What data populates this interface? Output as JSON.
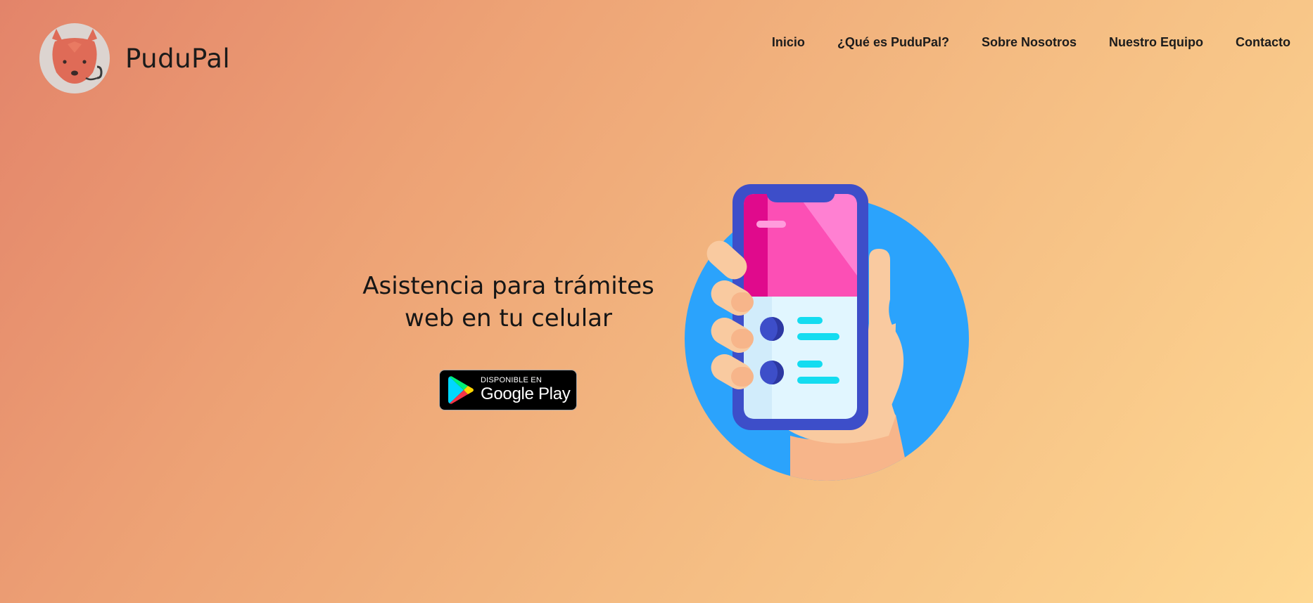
{
  "brand": {
    "name": "PuduPal",
    "logo_icon": "pudu-deer-icon"
  },
  "nav": {
    "items": [
      {
        "label": "Inicio"
      },
      {
        "label": "¿Qué es PuduPal?"
      },
      {
        "label": "Sobre Nosotros"
      },
      {
        "label": "Nuestro Equipo"
      },
      {
        "label": "Contacto"
      }
    ]
  },
  "hero": {
    "line1": "Asistencia para trámites",
    "line2": "web en tu celular",
    "badge": {
      "small": "DISPONIBLE EN",
      "big": "Google Play"
    },
    "illustration_icon": "hand-holding-phone-icon"
  },
  "colors": {
    "gradient_start": "#e3846a",
    "gradient_end": "#fed892",
    "circle": "#2ba3fc",
    "phone_frame": "#3d4ec9",
    "screen_pink": "#fc4fb5",
    "accent_cyan": "#14dcf0"
  }
}
